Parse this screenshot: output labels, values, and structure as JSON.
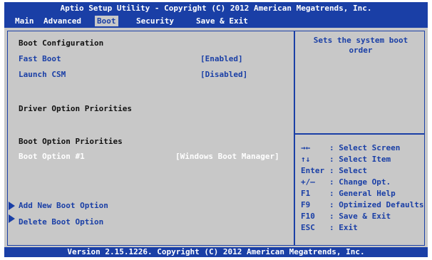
{
  "header": {
    "title": "Aptio Setup Utility - Copyright (C) 2012 American Megatrends, Inc.",
    "tabs": [
      {
        "label": "Main"
      },
      {
        "label": "Advanced"
      },
      {
        "label": "Boot"
      },
      {
        "label": "Security"
      },
      {
        "label": "Save & Exit"
      }
    ]
  },
  "main": {
    "boot_configuration": "Boot Configuration",
    "fast_boot": {
      "label": "Fast Boot",
      "value": "[Enabled]"
    },
    "launch_csm": {
      "label": "Launch CSM",
      "value": "[Disabled]"
    },
    "driver_option_priorities": "Driver Option Priorities",
    "boot_option_priorities": "Boot Option Priorities",
    "boot_option_1": {
      "label": "Boot Option #1",
      "value": "[Windows Boot Manager]"
    },
    "add_new_boot_option": "Add New Boot Option",
    "delete_boot_option": "Delete Boot Option"
  },
  "help": {
    "text": "Sets the system boot order"
  },
  "keys": [
    {
      "key": "→←",
      "desc": ": Select Screen"
    },
    {
      "key": "↑↓",
      "desc": ": Select Item"
    },
    {
      "key": "Enter",
      "desc": ": Select"
    },
    {
      "key": "+/—",
      "desc": ": Change Opt."
    },
    {
      "key": "F1",
      "desc": ": General Help"
    },
    {
      "key": "F9",
      "desc": ": Optimized Defaults"
    },
    {
      "key": "F10",
      "desc": ": Save & Exit"
    },
    {
      "key": "ESC",
      "desc": ": Exit"
    }
  ],
  "footer": {
    "text": "Version 2.15.1226. Copyright (C) 2012 American Megatrends, Inc."
  },
  "colors": {
    "accent_blue": "#1a3fa6",
    "background_gray": "#c8c8c8",
    "highlight_white": "#ffffff"
  }
}
